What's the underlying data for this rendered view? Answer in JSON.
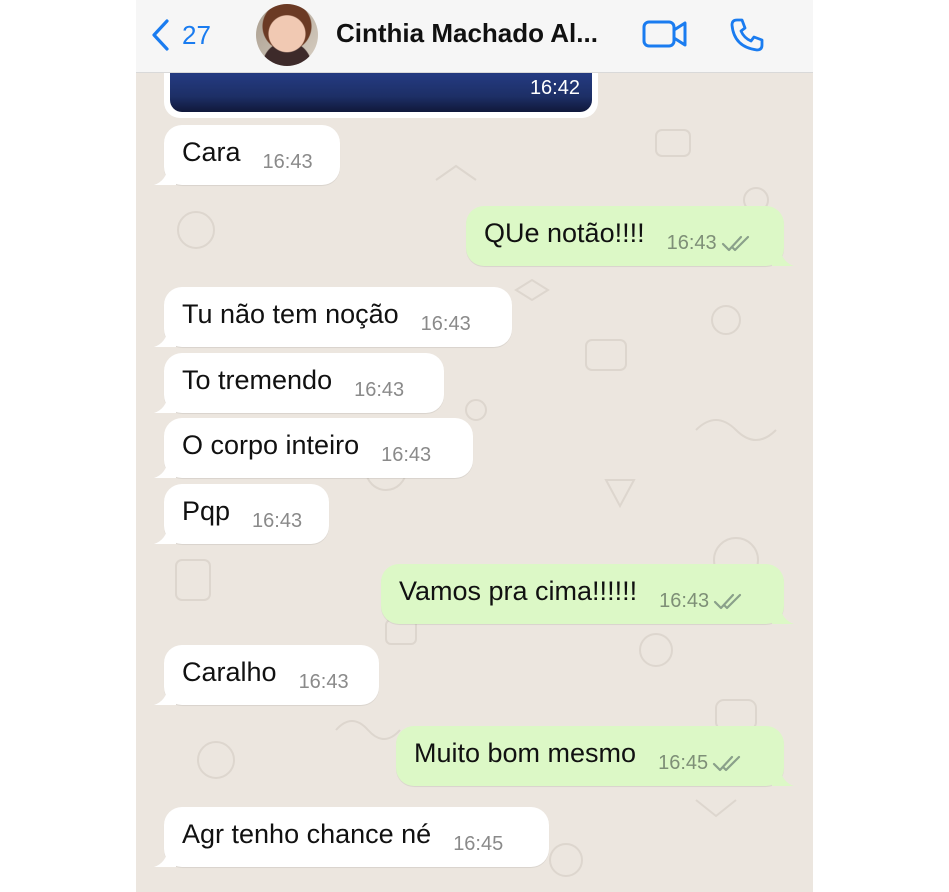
{
  "header": {
    "back_count": "27",
    "contact_name": "Cinthia Machado Al...",
    "accent_color": "#1a7cf0"
  },
  "image_message": {
    "time": "16:42"
  },
  "messages": [
    {
      "direction": "in",
      "text": "Cara",
      "time": "16:43"
    },
    {
      "direction": "out",
      "text": "QUe notão!!!!",
      "time": "16:43",
      "status": "read"
    },
    {
      "direction": "in",
      "text": "Tu não tem noção",
      "time": "16:43"
    },
    {
      "direction": "in",
      "text": "To tremendo",
      "time": "16:43"
    },
    {
      "direction": "in",
      "text": "O corpo inteiro",
      "time": "16:43"
    },
    {
      "direction": "in",
      "text": "Pqp",
      "time": "16:43"
    },
    {
      "direction": "out",
      "text": "Vamos pra cima!!!!!!",
      "time": "16:43",
      "status": "read"
    },
    {
      "direction": "in",
      "text": "Caralho",
      "time": "16:43"
    },
    {
      "direction": "out",
      "text": "Muito bom mesmo",
      "time": "16:45",
      "status": "read"
    },
    {
      "direction": "in",
      "text": "Agr tenho chance né",
      "time": "16:45"
    }
  ],
  "colors": {
    "chat_background": "#ece6df",
    "incoming_bubble": "#ffffff",
    "outgoing_bubble": "#dcf8c6"
  }
}
